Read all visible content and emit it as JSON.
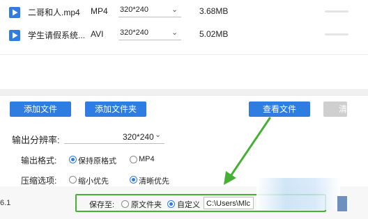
{
  "files": [
    {
      "name": "二哥和人.mp4",
      "format": "MP4",
      "resolution": "320*240",
      "size": "3.68MB",
      "icon": "video-play-icon"
    },
    {
      "name": "学生请假系统...",
      "format": "AVI",
      "resolution": "320*240",
      "size": "5.02MB",
      "icon": "video-play-icon"
    }
  ],
  "buttons": {
    "add_file": "添加文件",
    "add_folder": "添加文件夹",
    "view_file": "查看文件",
    "clear": "清"
  },
  "settings": {
    "resolution_label": "输出分辨率:",
    "resolution_value": "320*240",
    "format_label": "输出格式:",
    "format_options": [
      "保持原格式",
      "MP4"
    ],
    "format_selected": "保持原格式",
    "compress_label": "压缩选项:",
    "compress_options": [
      "缩小优先",
      "清晰优先"
    ],
    "compress_selected": "清晰优先"
  },
  "bottom": {
    "version": "6.1",
    "save_to_label": "保存至:",
    "save_options": [
      "原文件夹",
      "自定义"
    ],
    "save_selected": "自定义",
    "path_value": "C:\\Users\\Mlc"
  },
  "colors": {
    "accent": "#2f7de1",
    "annotation_green": "#46b035"
  }
}
